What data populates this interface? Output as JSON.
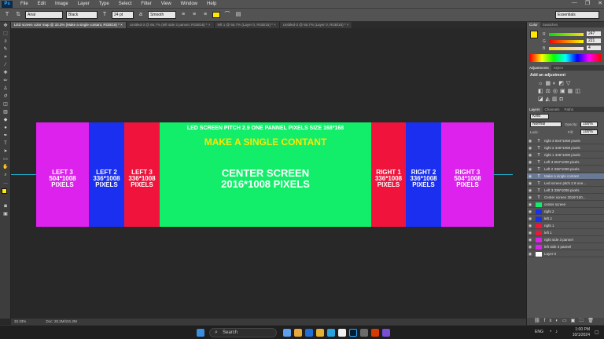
{
  "menubar": {
    "app_icon": "Ps",
    "items": [
      "File",
      "Edit",
      "Image",
      "Layer",
      "Type",
      "Select",
      "Filter",
      "View",
      "Window",
      "Help"
    ],
    "window_controls": [
      "—",
      "❐",
      "✕"
    ]
  },
  "options": {
    "font_family": "Arial",
    "font_style": "Black",
    "font_size": "24 pt",
    "aa_label": "a",
    "aa_mode": "Smooth",
    "text_color": "#ffe800",
    "workspace": "Essentials"
  },
  "tabs": [
    "LED screen color map @ 33.3% (Make a single contant, RGB/16) * ×",
    "Untitled-3 @ 66.7% (left side 3 pannel, RGB/16) * ×",
    "left 1 @ 66.7% (Layer 0, RGB/16) * ×",
    "Untitled-3 @ 66.7% (Layer 0, RGB/16) * ×"
  ],
  "canvas": {
    "header_line": "LED SCREEN PITCH 2.9    ONE PANNEL PIXELS SIZE 168*168",
    "title": "MAKE A SINGLE CONTANT",
    "panels": [
      {
        "id": "left3",
        "line1": "LEFT 3",
        "line2": "504*1008",
        "line3": "PIXELS",
        "color": "#dd22ee"
      },
      {
        "id": "left2",
        "line1": "LEFT 2",
        "line2": "336*1008",
        "line3": "PIXELS",
        "color": "#1a2ff0"
      },
      {
        "id": "left1",
        "line1": "LEFT 3",
        "line2": "336*1008",
        "line3": "PIXELS",
        "color": "#f0143c"
      },
      {
        "id": "center",
        "line1": "CENTER SCREEN",
        "line2": "2016*1008 PIXELS",
        "line3": "",
        "color": "#12ee6a"
      },
      {
        "id": "right1",
        "line1": "RIGHT 1",
        "line2": "336*1008",
        "line3": "PIXELS",
        "color": "#f0143c"
      },
      {
        "id": "right2",
        "line1": "RIGHT 2",
        "line2": "336*1008",
        "line3": "PIXELS",
        "color": "#1a2ff0"
      },
      {
        "id": "right3",
        "line1": "RIGHT 3",
        "line2": "504*1008",
        "line3": "PIXELS",
        "color": "#dd22ee"
      }
    ]
  },
  "status": {
    "zoom": "33.33%",
    "doc": "Doc: 20.2M/101.2M"
  },
  "color_panel": {
    "tabs": [
      "Color",
      "Swatches"
    ],
    "r_label": "R",
    "r_value": "247",
    "g_label": "G",
    "g_value": "221",
    "b_label": "B",
    "b_value": "4"
  },
  "adjustments": {
    "tabs": [
      "Adjustments",
      "Styles"
    ],
    "add_label": "Add an adjustment"
  },
  "layers_panel": {
    "tabs": [
      "Layers",
      "Channels",
      "Paths"
    ],
    "kind": "Kind",
    "blend": "Normal",
    "opacity_label": "Opacity:",
    "opacity": "100%",
    "lock_label": "Lock:",
    "fill_label": "Fill:",
    "fill": "100%",
    "layers": [
      {
        "name": "right 3 504*1008 pixels",
        "type": "T"
      },
      {
        "name": "right 2 336*1008 pixels",
        "type": "T"
      },
      {
        "name": "right 1 336*1008 pixels",
        "type": "T"
      },
      {
        "name": "Left 3 504*1008 pixels",
        "type": "T"
      },
      {
        "name": "Left 2 336*1008 pixels",
        "type": "T"
      },
      {
        "name": "Make a single contant",
        "type": "T"
      },
      {
        "name": "Led screen pitch 2.9  one...",
        "type": "T"
      },
      {
        "name": "Left 3 336*1008 pixels",
        "type": "T"
      },
      {
        "name": "Center screen  2016*100...",
        "type": "T"
      },
      {
        "name": "center screen",
        "type": ""
      },
      {
        "name": "right 2",
        "type": ""
      },
      {
        "name": "left 2",
        "type": ""
      },
      {
        "name": "right 1",
        "type": ""
      },
      {
        "name": "left 1",
        "type": ""
      },
      {
        "name": "right side 3 pannel",
        "type": ""
      },
      {
        "name": "left side 3 pannel",
        "type": ""
      },
      {
        "name": "Layer 0",
        "type": ""
      }
    ]
  },
  "taskbar": {
    "search_placeholder": "Search",
    "lang": "ENG",
    "time": "1:00 PM",
    "date": "10/1/2024"
  }
}
